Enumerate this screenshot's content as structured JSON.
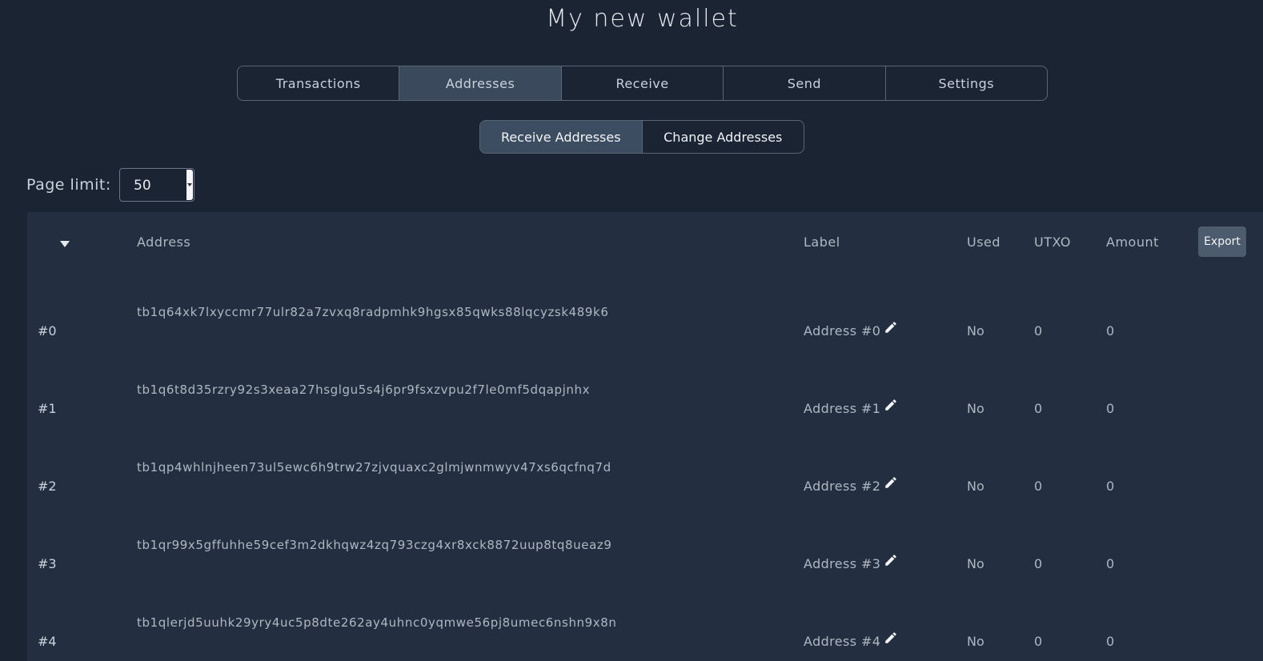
{
  "wallet": {
    "title": "My new wallet"
  },
  "main_tabs": [
    {
      "label": "Transactions",
      "active": false
    },
    {
      "label": "Addresses",
      "active": true
    },
    {
      "label": "Receive",
      "active": false
    },
    {
      "label": "Send",
      "active": false
    },
    {
      "label": "Settings",
      "active": false
    }
  ],
  "sub_tabs": [
    {
      "label": "Receive Addresses",
      "active": true
    },
    {
      "label": "Change Addresses",
      "active": false
    }
  ],
  "page_limit": {
    "label": "Page limit:",
    "value": "50"
  },
  "table": {
    "headers": {
      "address": "Address",
      "label": "Label",
      "used": "Used",
      "utxo": "UTXO",
      "amount": "Amount"
    },
    "export_label": "Export",
    "rows": [
      {
        "index": "#0",
        "address": "tb1q64xk7lxyccmr77ulr82a7zvxq8radpmhk9hgsx85qwks88lqcyzsk489k6",
        "label": "Address #0",
        "used": "No",
        "utxo": "0",
        "amount": "0"
      },
      {
        "index": "#1",
        "address": "tb1q6t8d35rzry92s3xeaa27hsglgu5s4j6pr9fsxzvpu2f7le0mf5dqapjnhx",
        "label": "Address #1",
        "used": "No",
        "utxo": "0",
        "amount": "0"
      },
      {
        "index": "#2",
        "address": "tb1qp4whlnjheen73ul5ewc6h9trw27zjvquaxc2glmjwnmwyv47xs6qcfnq7d",
        "label": "Address #2",
        "used": "No",
        "utxo": "0",
        "amount": "0"
      },
      {
        "index": "#3",
        "address": "tb1qr99x5gffuhhe59cef3m2dkhqwz4zq793czg4xr8xck8872uup8tq8ueaz9",
        "label": "Address #3",
        "used": "No",
        "utxo": "0",
        "amount": "0"
      },
      {
        "index": "#4",
        "address": "tb1qlerjd5uuhk29yry4uc5p8dte262ay4uhnc0yqmwe56pj8umec6nshn9x8n",
        "label": "Address #4",
        "used": "No",
        "utxo": "0",
        "amount": "0"
      }
    ]
  },
  "icons": {
    "sort": "sort-desc-icon",
    "edit": "pencil-icon"
  },
  "colors": {
    "background": "#1a2433",
    "panel": "#232f40",
    "active_tab": "#3a4a5c",
    "button": "#4c5b6d"
  }
}
